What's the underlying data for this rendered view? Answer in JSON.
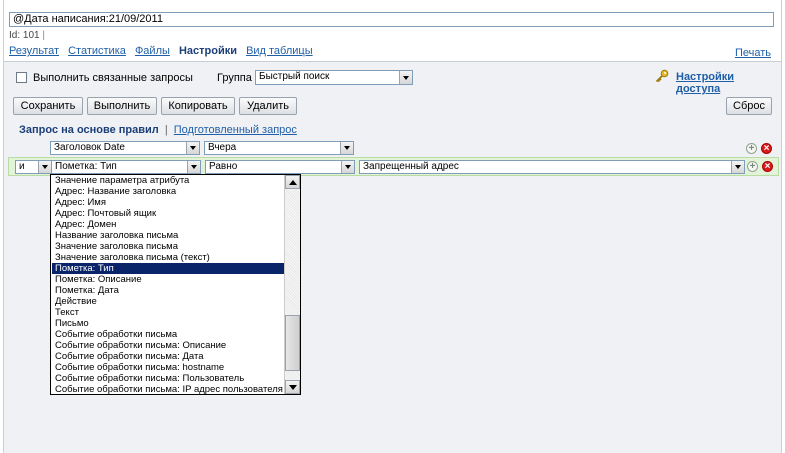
{
  "title_field": {
    "value": "@Дата написания:21/09/2011"
  },
  "id_line": {
    "label": "Id:",
    "value": "101"
  },
  "tabs": [
    {
      "label": "Результат"
    },
    {
      "label": "Статистика"
    },
    {
      "label": "Файлы"
    },
    {
      "label": "Настройки"
    },
    {
      "label": "Вид таблицы"
    }
  ],
  "print_link": "Печать",
  "options": {
    "linked_queries_label": "Выполнить связанные запросы",
    "group_label": "Группа",
    "group_value": "Быстрый поиск",
    "access_settings_label": "Настройки доступа"
  },
  "buttons": {
    "save": "Сохранить",
    "run": "Выполнить",
    "copy": "Копировать",
    "delete": "Удалить",
    "reset": "Сброс"
  },
  "query_tabs": {
    "rules": "Запрос на основе правил",
    "prepared": "Подготовленный запрос"
  },
  "row1": {
    "field": "Заголовок Date",
    "operator": "Вчера"
  },
  "row2": {
    "conjunction": "и",
    "field": "Пометка: Тип",
    "operator": "Равно",
    "value": "Запрещенный адрес"
  },
  "dropdown_items": [
    "Значение параметра атрибута",
    "Адрес: Название заголовка",
    "Адрес: Имя",
    "Адрес: Почтовый ящик",
    "Адрес: Домен",
    "Название заголовка письма",
    "Значение заголовка письма",
    "Значение заголовка письма (текст)",
    "Пометка: Тип",
    "Пометка: Описание",
    "Пометка: Дата",
    "Действие",
    "Текст",
    "Письмо",
    "Событие обработки письма",
    "Событие обработки письма: Описание",
    "Событие обработки письма: Дата",
    "Событие обработки письма: hostname",
    "Событие обработки письма: Пользователь",
    "Событие обработки письма: IP адрес пользователя"
  ],
  "dropdown_selected": "Пометка: Тип",
  "icons": {
    "key": "key-icon",
    "add": "plus-circle-icon",
    "remove": "delete-circle-icon"
  }
}
